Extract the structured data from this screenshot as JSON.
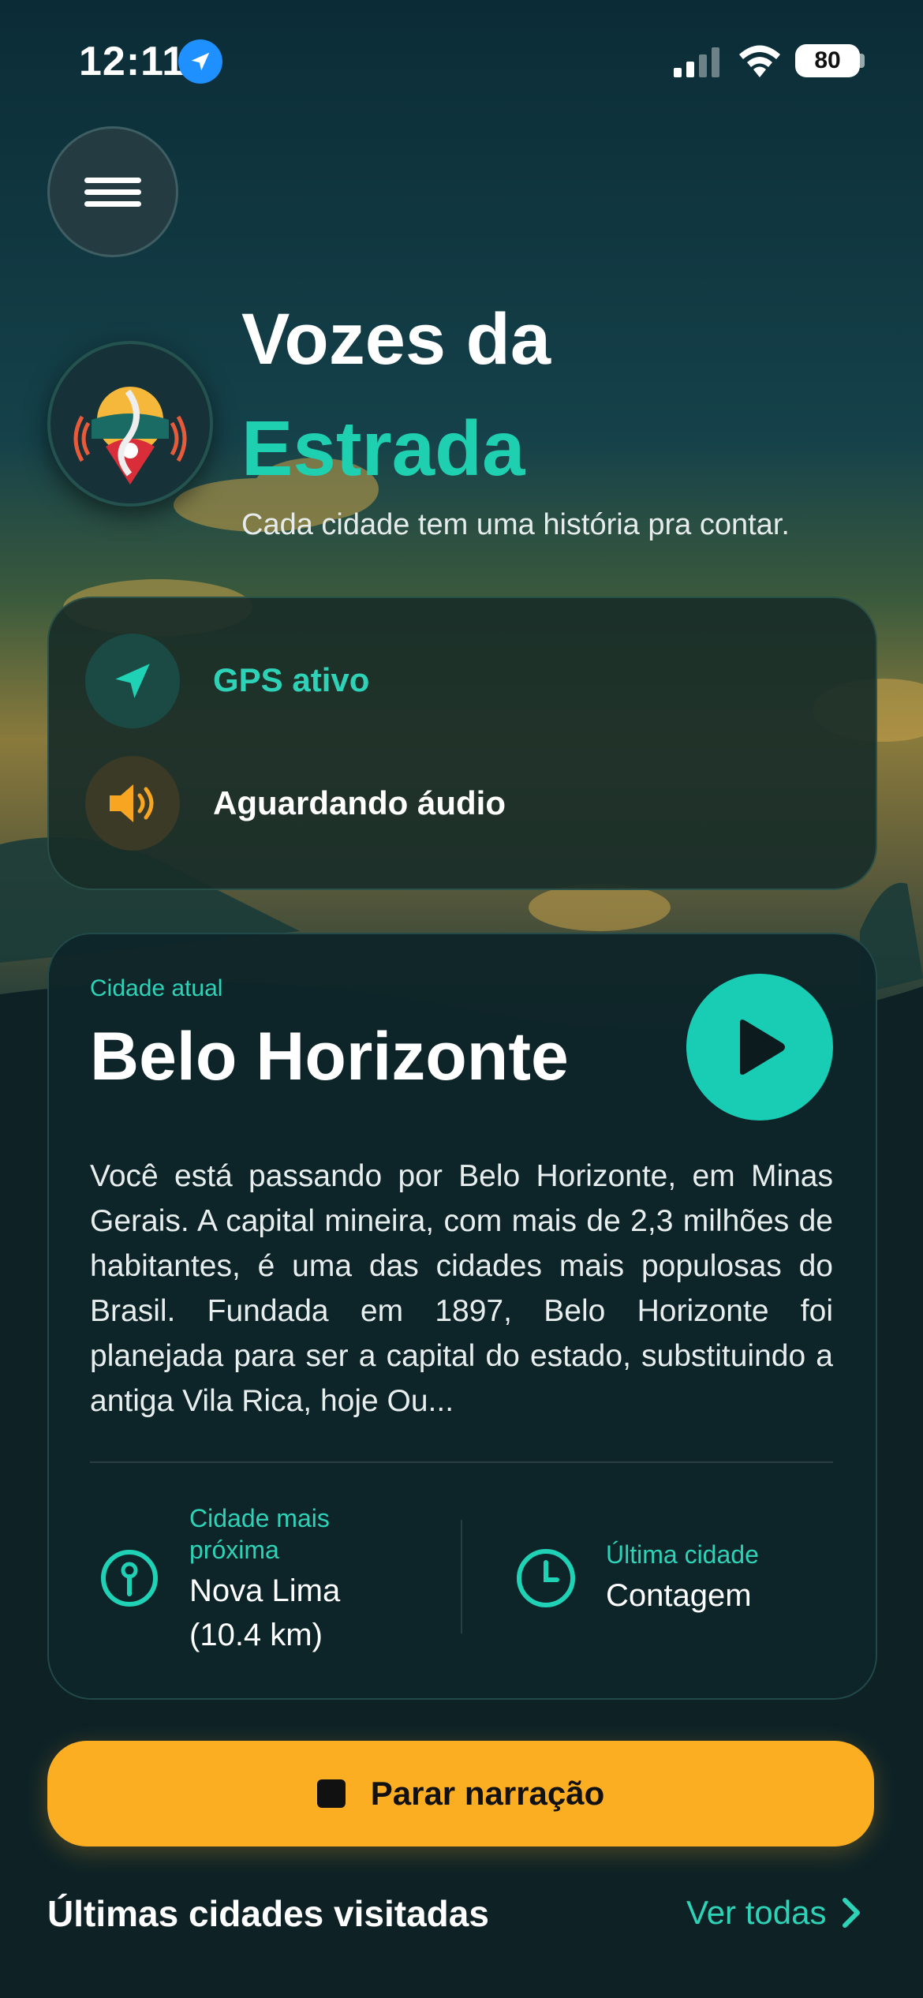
{
  "status_bar": {
    "time": "12:11",
    "battery": "80"
  },
  "app": {
    "title_line1": "Vozes da",
    "title_line2": "Estrada",
    "tagline": "Cada cidade tem uma história pra contar."
  },
  "status": {
    "gps": "GPS ativo",
    "audio": "Aguardando áudio"
  },
  "city": {
    "label": "Cidade atual",
    "name": "Belo Horizonte",
    "description": "Você está passando por Belo Horizonte, em Minas Gerais. A capital mineira, com mais de 2,3 milhões de habitantes, é uma das cidades mais populosas do Brasil. Fundada em 1897, Belo Horizonte foi planejada para ser a capital do estado, substituindo a antiga Vila Rica, hoje Ou...",
    "nearby_label": "Cidade mais próxima",
    "nearby_value": "Nova Lima (10.4 km)",
    "last_label": "Última cidade",
    "last_value": "Contagem"
  },
  "actions": {
    "stop_label": "Parar narração"
  },
  "recent": {
    "title": "Últimas cidades visitadas",
    "see_all": "Ver todas"
  },
  "colors": {
    "accent": "#1ecfb0",
    "button": "#fcae23",
    "background": "#0d2a31"
  },
  "icons": {
    "menu": "hamburger-icon",
    "gps": "navigation-arrow-icon",
    "audio": "speaker-icon",
    "play": "play-icon",
    "nearby": "map-pin-icon",
    "last": "clock-icon",
    "stop": "stop-icon",
    "see_all": "chevron-right-icon"
  }
}
